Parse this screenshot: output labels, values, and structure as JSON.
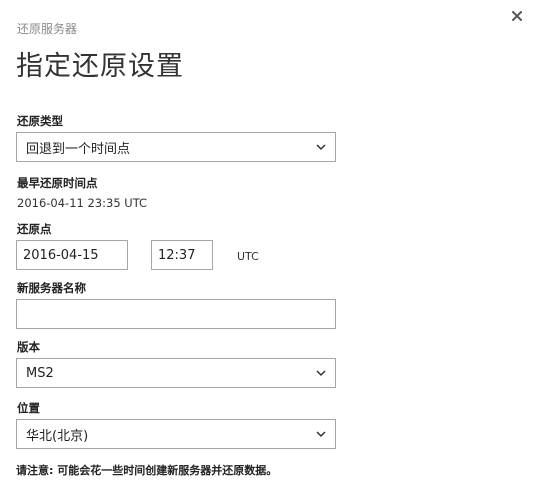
{
  "dialog": {
    "subtitle": "还原服务器",
    "title": "指定还原设置"
  },
  "restore_type": {
    "label": "还原类型",
    "selected": "回退到一个时间点"
  },
  "earliest_restore": {
    "label": "最早还原时间点",
    "value": "2016-04-11 23:35 UTC"
  },
  "restore_point": {
    "label": "还原点",
    "date_value": "2016-04-15",
    "time_value": "12:37",
    "timezone": "UTC"
  },
  "new_server_name": {
    "label": "新服务器名称",
    "value": ""
  },
  "version": {
    "label": "版本",
    "selected": "MS2"
  },
  "location": {
    "label": "位置",
    "selected": "华北(北京)"
  },
  "note": "请注意: 可能会花一些时间创建新服务器并还原数据。",
  "icons": {
    "close": "close-icon",
    "dropdown": "chevron-down-icon"
  }
}
